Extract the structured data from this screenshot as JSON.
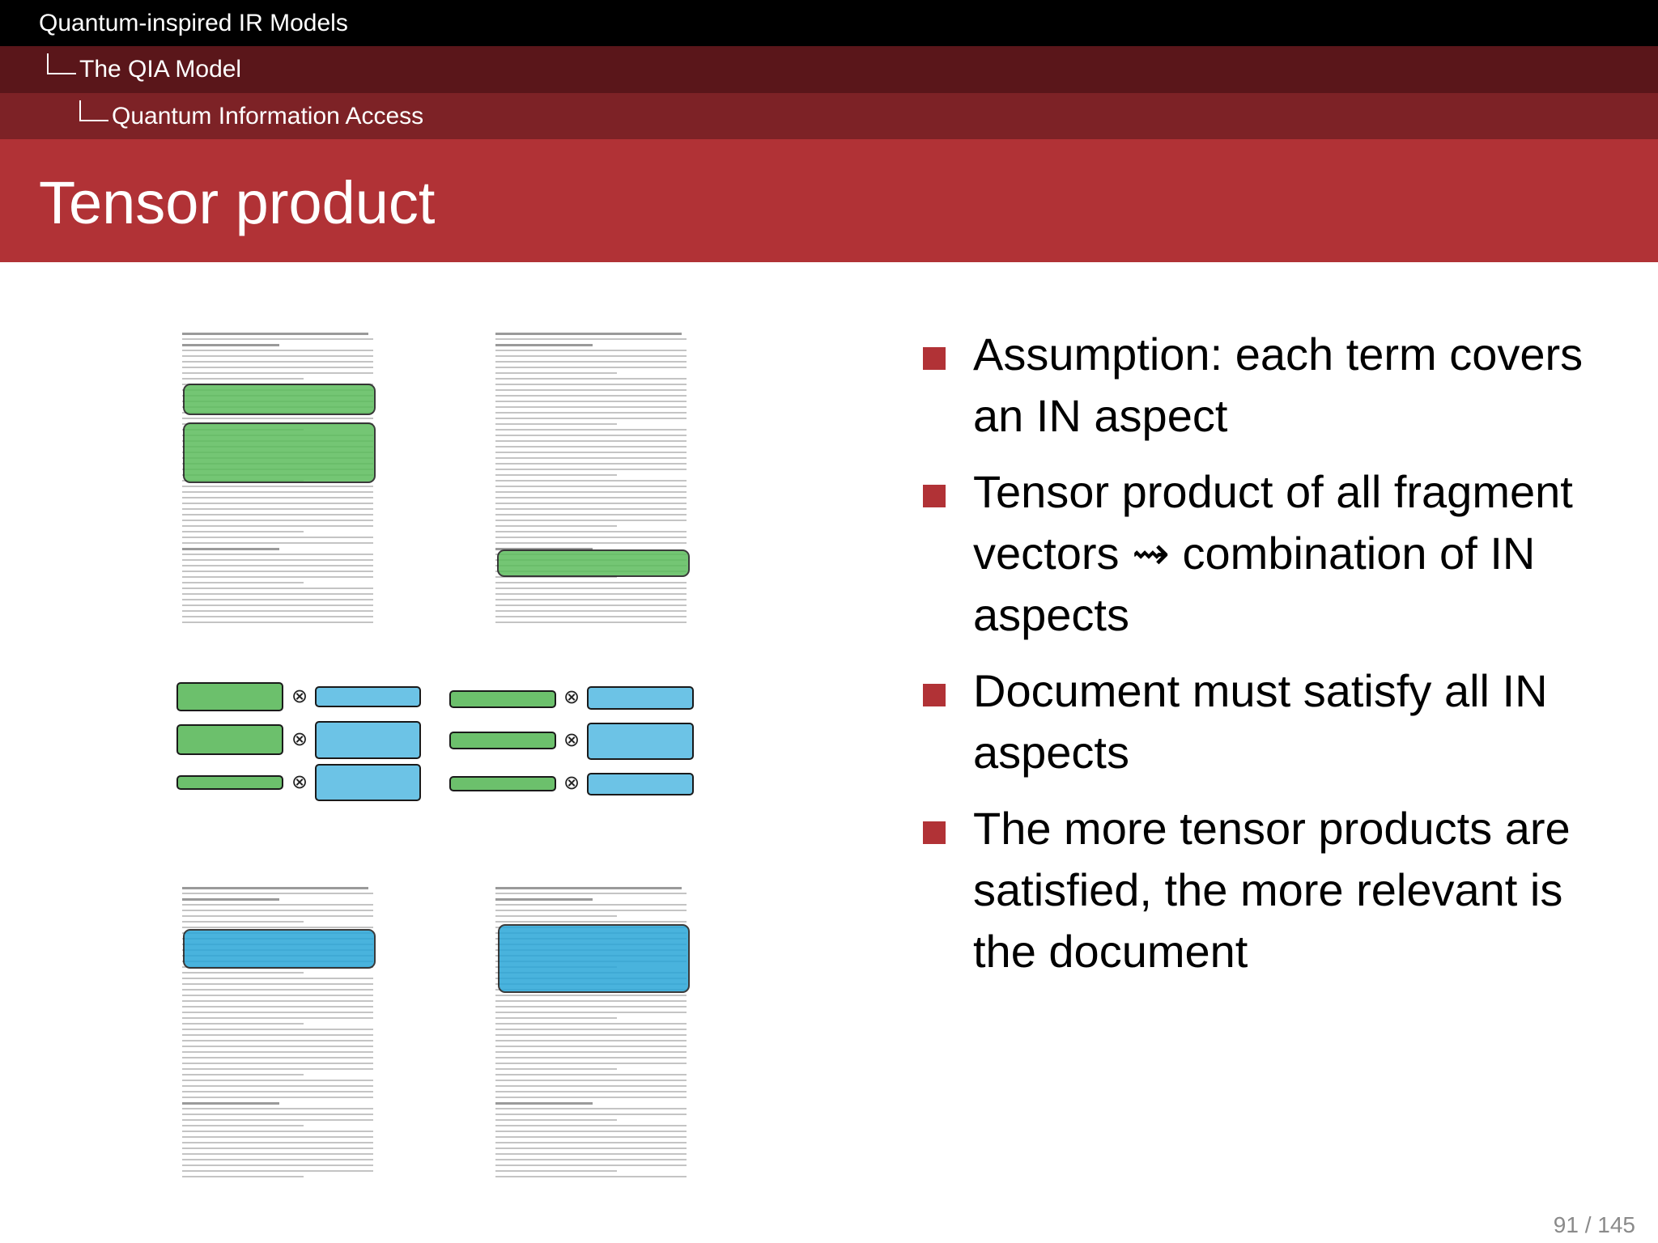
{
  "breadcrumb": {
    "section": "Quantum-inspired IR Models",
    "subsection": "The QIA Model",
    "subsubsection": "Quantum Information Access"
  },
  "title": "Tensor product",
  "bullets": [
    "Assumption: each term covers an IN aspect",
    "Tensor product of all fragment vectors ⇝ combination of IN aspects",
    "Document must satisfy all IN aspects",
    "The more tensor products are satisfied, the more relevant is the document"
  ],
  "diagram": {
    "operator_symbol": "⊗",
    "colors": {
      "term_fragment": "#6cc06c",
      "document_fragment": "#6cc3e6",
      "accent": "#b13236"
    }
  },
  "page_number": "91 / 145"
}
